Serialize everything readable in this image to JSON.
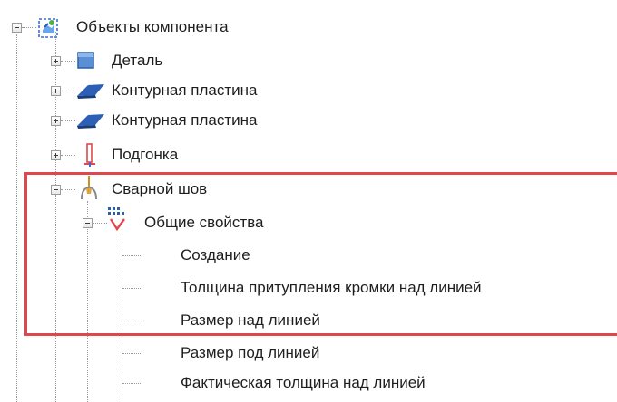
{
  "tree": {
    "root": {
      "label": "Объекты компонента",
      "icon": "component-objects-icon"
    },
    "children": [
      {
        "label": "Деталь",
        "icon": "part-icon"
      },
      {
        "label": "Контурная пластина",
        "icon": "contour-plate-icon"
      },
      {
        "label": "Контурная пластина",
        "icon": "contour-plate-icon"
      },
      {
        "label": "Подгонка",
        "icon": "fitting-icon"
      },
      {
        "label": "Сварной шов",
        "icon": "weld-icon"
      }
    ],
    "weld_group": {
      "label": "Общие свойства",
      "icon": "general-properties-icon"
    },
    "properties": [
      "Создание",
      "Толщина притупления кромки над линией",
      "Размер над линией",
      "Размер под линией",
      "Фактическая толщина над линией"
    ]
  },
  "colors": {
    "highlight_border": "#e0474c",
    "part_icon": "#5a8fd6",
    "fitting_icon": "#e0474c",
    "weld_icon": "#c9911e"
  }
}
